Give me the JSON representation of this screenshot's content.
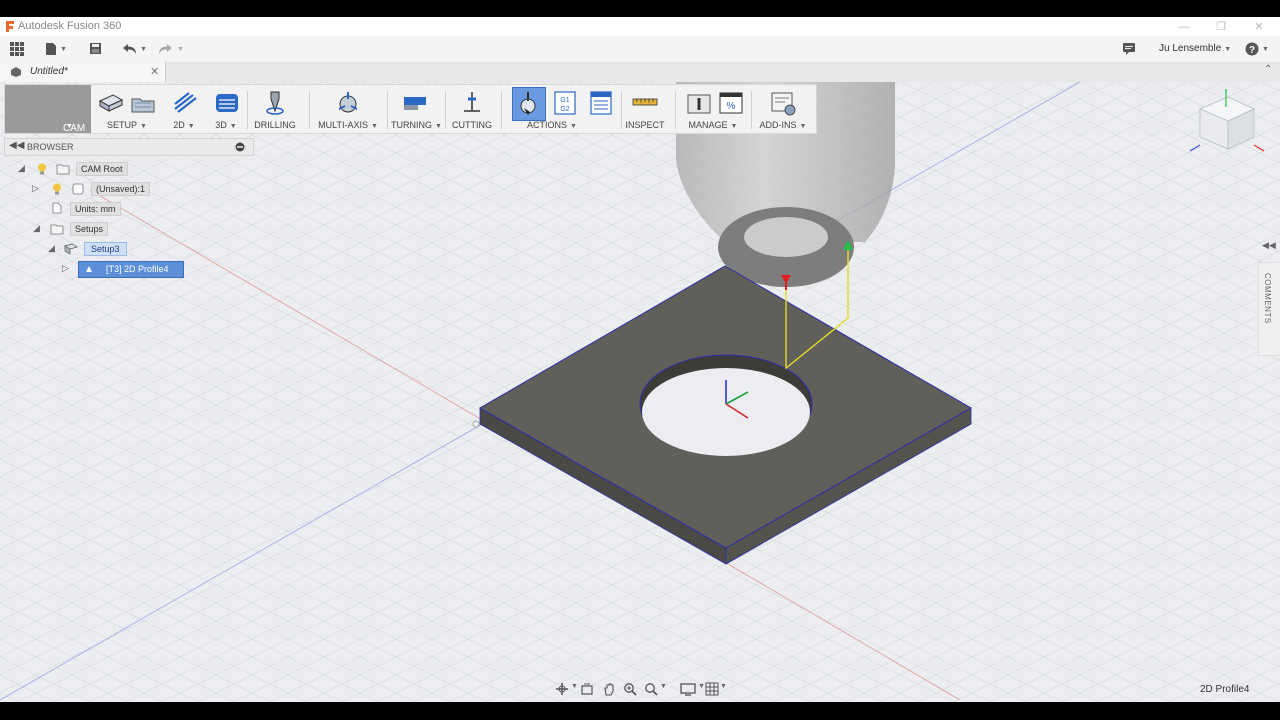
{
  "window": {
    "title": "Autodesk Fusion 360"
  },
  "qat": {
    "user_name": "Ju Lensemble"
  },
  "document_tab": {
    "title": "Untitled*"
  },
  "workspace": {
    "label": "CAM"
  },
  "toolbar": {
    "groups": [
      {
        "label": "SETUP"
      },
      {
        "label": "2D"
      },
      {
        "label": "3D"
      },
      {
        "label": "DRILLING"
      },
      {
        "label": "MULTI-AXIS"
      },
      {
        "label": "TURNING"
      },
      {
        "label": "CUTTING"
      },
      {
        "label": "ACTIONS"
      },
      {
        "label": "INSPECT"
      },
      {
        "label": "MANAGE"
      },
      {
        "label": "ADD-INS"
      }
    ]
  },
  "browser": {
    "title": "BROWSER",
    "nodes": [
      {
        "label": "CAM Root"
      },
      {
        "label": "(Unsaved):1"
      },
      {
        "label": "Units: mm"
      },
      {
        "label": "Setups"
      },
      {
        "label": "Setup3"
      },
      {
        "label": "[T3] 2D Profile4"
      }
    ]
  },
  "comments": {
    "label": "COMMENTS"
  },
  "status": {
    "text": "2D Profile4"
  },
  "colors": {
    "selection_blue": "#5b8fd8",
    "part_gray": "#5e5c57",
    "workspace_gray": "#9a9a9a"
  }
}
